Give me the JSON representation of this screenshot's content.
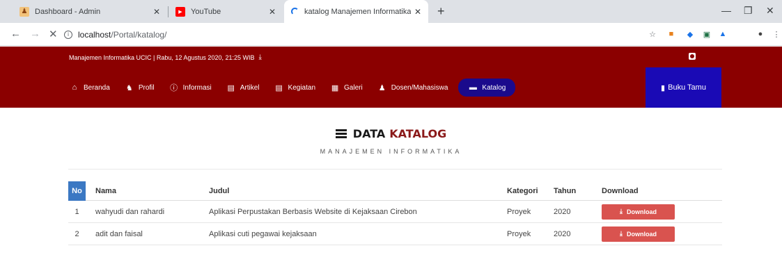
{
  "browser": {
    "tabs": [
      {
        "title": "Dashboard - Admin",
        "active": false
      },
      {
        "title": "YouTube",
        "active": false
      },
      {
        "title": "katalog Manajemen Informatika",
        "active": true
      }
    ],
    "url_host": "localhost",
    "url_path": "/Portal/katalog/"
  },
  "site": {
    "topline": "Manajemen Informatika UCIC | Rabu, 12 Agustus 2020, 21:25 WIB",
    "menu": [
      {
        "label": "Beranda",
        "icon": "home-icon"
      },
      {
        "label": "Profil",
        "icon": "profile-icon"
      },
      {
        "label": "Informasi",
        "icon": "info-icon"
      },
      {
        "label": "Artikel",
        "icon": "newspaper-icon"
      },
      {
        "label": "Kegiatan",
        "icon": "newspaper-icon"
      },
      {
        "label": "Galeri",
        "icon": "image-icon"
      },
      {
        "label": "Dosen/Mahasiswa",
        "icon": "user-icon"
      },
      {
        "label": "Katalog",
        "icon": "folder-icon",
        "active": true
      }
    ],
    "buku_tamu": "Buku Tamu"
  },
  "page": {
    "title_main": "DATA",
    "title_accent": "KATALOG",
    "subtitle": "MANAJEMEN INFORMATIKA"
  },
  "table": {
    "headers": {
      "no": "No",
      "nama": "Nama",
      "judul": "Judul",
      "kategori": "Kategori",
      "tahun": "Tahun",
      "download": "Download"
    },
    "rows": [
      {
        "no": "1",
        "nama": "wahyudi dan rahardi",
        "judul": "Aplikasi Perpustakan Berbasis Website di Kejaksaan Cirebon",
        "kategori": "Proyek",
        "tahun": "2020",
        "download": "Download"
      },
      {
        "no": "2",
        "nama": "adit dan faisal",
        "judul": "Aplikasi cuti pegawai kejaksaan",
        "kategori": "Proyek",
        "tahun": "2020",
        "download": "Download"
      }
    ]
  },
  "colors": {
    "header_red": "#8b0000",
    "menu_active": "#1a0a8c",
    "buku_tamu_bg": "#1a0ab5",
    "no_header": "#3b78c3",
    "download_btn": "#d9534f"
  }
}
